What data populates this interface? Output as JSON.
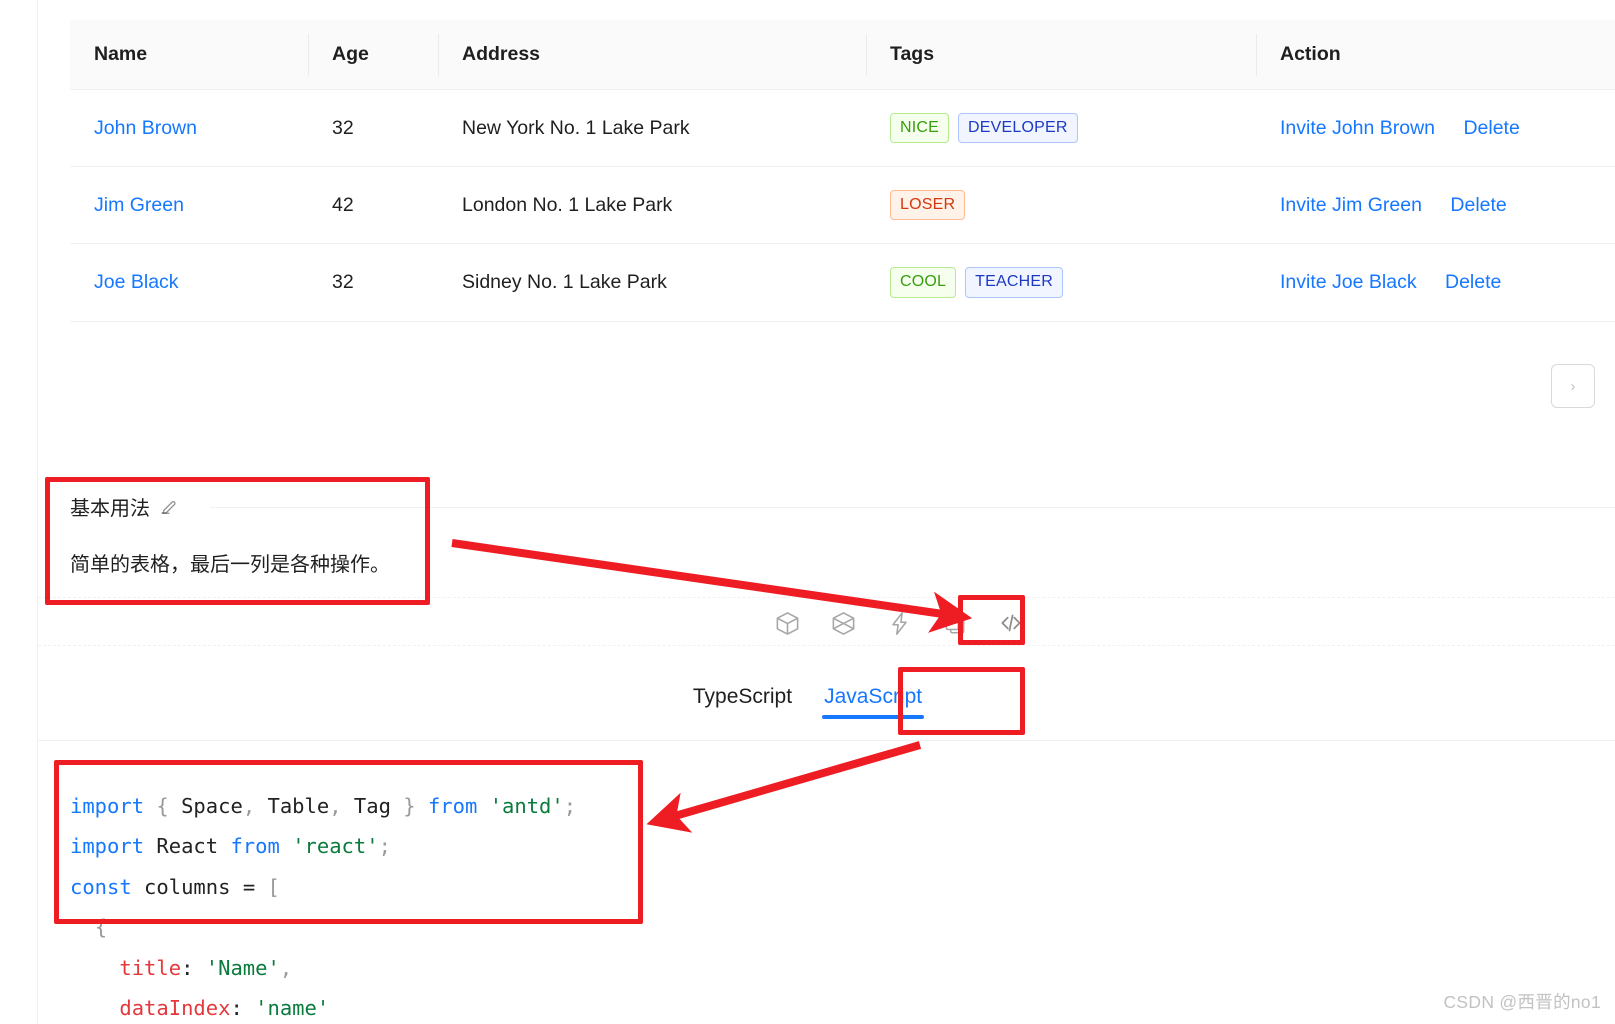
{
  "table": {
    "columns": [
      {
        "key": "name",
        "label": "Name"
      },
      {
        "key": "age",
        "label": "Age"
      },
      {
        "key": "address",
        "label": "Address"
      },
      {
        "key": "tags",
        "label": "Tags"
      },
      {
        "key": "action",
        "label": "Action"
      }
    ],
    "rows": [
      {
        "name": "John Brown",
        "age": "32",
        "address": "New York No. 1 Lake Park",
        "tags": [
          {
            "text": "NICE",
            "color": "green"
          },
          {
            "text": "DEVELOPER",
            "color": "geekblue"
          }
        ],
        "invite": "Invite John Brown",
        "delete": "Delete"
      },
      {
        "name": "Jim Green",
        "age": "42",
        "address": "London No. 1 Lake Park",
        "tags": [
          {
            "text": "LOSER",
            "color": "volcano"
          }
        ],
        "invite": "Invite Jim Green",
        "delete": "Delete"
      },
      {
        "name": "Joe Black",
        "age": "32",
        "address": "Sidney No. 1 Lake Park",
        "tags": [
          {
            "text": "COOL",
            "color": "green"
          },
          {
            "text": "TEACHER",
            "color": "geekblue"
          }
        ],
        "invite": "Invite Joe Black",
        "delete": "Delete"
      }
    ],
    "pagination": {
      "next_label": "›"
    }
  },
  "description": {
    "title": "基本用法",
    "edit_icon": "edit-pencil-icon",
    "body": "简单的表格，最后一列是各种操作。"
  },
  "toolbar": {
    "icons": [
      {
        "name": "codesandbox-icon",
        "title": "CodeSandbox"
      },
      {
        "name": "codepen-icon",
        "title": "CodePen"
      },
      {
        "name": "stackblitz-lightning-icon",
        "title": "StackBlitz"
      },
      {
        "name": "copy-clipboard-icon",
        "title": "Copy"
      },
      {
        "name": "show-code-icon",
        "title": "Show Code"
      }
    ]
  },
  "language_tabs": {
    "items": [
      {
        "label": "TypeScript",
        "active": false
      },
      {
        "label": "JavaScript",
        "active": true
      }
    ]
  },
  "code": {
    "language": "JavaScript",
    "lines": [
      [
        {
          "t": "import",
          "c": "kw"
        },
        {
          "t": " ",
          "c": "plain"
        },
        {
          "t": "{",
          "c": "punct"
        },
        {
          "t": " Space",
          "c": "plain"
        },
        {
          "t": ",",
          "c": "punct"
        },
        {
          "t": " Table",
          "c": "plain"
        },
        {
          "t": ",",
          "c": "punct"
        },
        {
          "t": " Tag ",
          "c": "plain"
        },
        {
          "t": "}",
          "c": "punct"
        },
        {
          "t": " ",
          "c": "plain"
        },
        {
          "t": "from",
          "c": "kw"
        },
        {
          "t": " ",
          "c": "plain"
        },
        {
          "t": "'antd'",
          "c": "str"
        },
        {
          "t": ";",
          "c": "punct"
        }
      ],
      [
        {
          "t": "import",
          "c": "kw"
        },
        {
          "t": " React ",
          "c": "plain"
        },
        {
          "t": "from",
          "c": "kw"
        },
        {
          "t": " ",
          "c": "plain"
        },
        {
          "t": "'react'",
          "c": "str"
        },
        {
          "t": ";",
          "c": "punct"
        }
      ],
      [
        {
          "t": "const",
          "c": "kw"
        },
        {
          "t": " columns ",
          "c": "plain"
        },
        {
          "t": "=",
          "c": "plain"
        },
        {
          "t": " ",
          "c": "plain"
        },
        {
          "t": "[",
          "c": "punct"
        }
      ],
      [
        {
          "t": "  ",
          "c": "plain"
        },
        {
          "t": "{",
          "c": "punct"
        }
      ],
      [
        {
          "t": "    ",
          "c": "plain"
        },
        {
          "t": "title",
          "c": "prop"
        },
        {
          "t": ": ",
          "c": "plain"
        },
        {
          "t": "'Name'",
          "c": "str"
        },
        {
          "t": ",",
          "c": "punct"
        }
      ],
      [
        {
          "t": "    ",
          "c": "plain"
        },
        {
          "t": "dataIndex",
          "c": "prop"
        },
        {
          "t": ": ",
          "c": "plain"
        },
        {
          "t": "'name'",
          "c": "str"
        }
      ]
    ]
  },
  "annotations": {
    "color": "#ee1c23",
    "boxes": [
      {
        "name": "description-highlight"
      },
      {
        "name": "show-code-icon-highlight"
      },
      {
        "name": "javascript-tab-highlight"
      },
      {
        "name": "code-block-highlight"
      }
    ],
    "arrows": [
      {
        "name": "arrow-description-to-code-icon"
      },
      {
        "name": "arrow-javascript-tab-to-code-block"
      }
    ]
  },
  "watermark": "CSDN @西晋的no1"
}
